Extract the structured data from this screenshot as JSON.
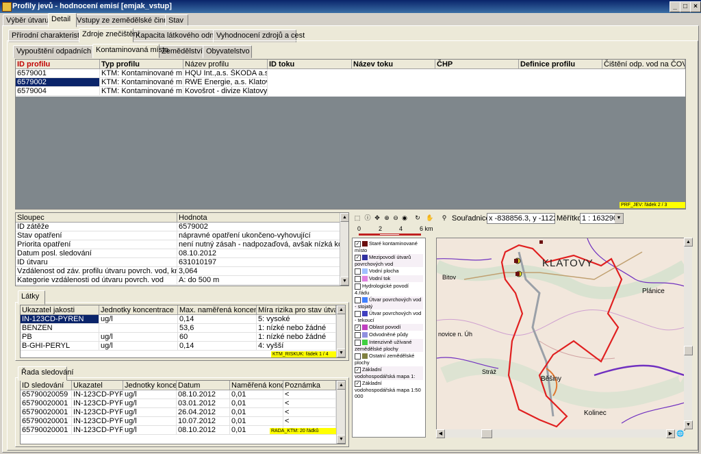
{
  "window": {
    "title": "Profily jevů - hodnocení emisí [emjak_vstup]"
  },
  "main_tabs": [
    "Výběr útvaru",
    "Detail",
    "Vstupy ze zemědělské činnosti",
    "Stav"
  ],
  "sub_tabs": [
    "Přírodní charakteristiky",
    "Zdroje znečištění",
    "Kapacita látkového odnosu",
    "Vyhodnocení zdrojů a cest"
  ],
  "source_tabs": [
    "Vypouštění odpadních vod",
    "Kontaminovaná místa",
    "Zemědělství",
    "Obyvatelstvo"
  ],
  "profiles": {
    "headers": [
      "ID profilu",
      "Typ profilu",
      "Název profilu",
      "ID toku",
      "Název toku",
      "ČHP",
      "Definice profilu",
      "Čištění odp. vod na ČOV"
    ],
    "rows": [
      [
        "6579001",
        "KTM: Kontaminované místo",
        "HQU Int.,a.s. ŠKODA a.s  Klat"
      ],
      [
        "6579002",
        "KTM: Kontaminované místo",
        "RWE Energie, a.s. Klatovy"
      ],
      [
        "6579004",
        "KTM: Kontaminované místo",
        "Kovošrot - divize Klatovy"
      ]
    ],
    "status": "PRF_JEV: řádek 2 / 3"
  },
  "details": {
    "headers": [
      "Sloupec",
      "Hodnota"
    ],
    "rows": [
      [
        "ID zátěže",
        "6579002"
      ],
      [
        "Stav opatření",
        "nápravné opatření ukončeno-vyhovující"
      ],
      [
        "Priorita opatření",
        "není nutný zásah - nadpozaďová, avšak nízká  kontaminac"
      ],
      [
        "Datum posl. sledování",
        "08.10.2012"
      ],
      [
        "ID útvaru",
        "631010197"
      ],
      [
        "Vzdálenost od záv. profilu útvaru povrch. vod, km",
        "3,064"
      ],
      [
        "Kategorie vzdálenosti od útvaru povrch. vod",
        "A: do 500 m"
      ]
    ]
  },
  "latky": {
    "tab": "Látky",
    "headers": [
      "Ukazatel jakosti",
      "Jednotky koncentrace",
      "Max. naměřená koncentrac",
      "Míra rizika pro stav útvaru p"
    ],
    "rows": [
      [
        "IN-123CD-PYREN",
        "ug/l",
        "0,14",
        "5: vysoké"
      ],
      [
        "BENZEN",
        "",
        "53,6",
        "1: nízké nebo žádné"
      ],
      [
        "PB",
        "ug/l",
        "60",
        "1: nízké nebo žádné"
      ],
      [
        "B-GHI-PERYL",
        "ug/l",
        "0,14",
        "4: vyšší"
      ]
    ],
    "status": "KTM_RISKUK: řádek 1 / 4"
  },
  "rada": {
    "tab": "Řada sledování",
    "headers": [
      "ID sledování",
      "Ukazatel",
      "Jednotky koncen",
      "Datum",
      "Naměřená koncer",
      "Poznámka"
    ],
    "rows": [
      [
        "65790020059",
        "IN-123CD-PYREN",
        "ug/l",
        "08.10.2012",
        "0,01",
        "<"
      ],
      [
        "65790020001",
        "IN-123CD-PYREN",
        "ug/l",
        "03.01.2012",
        "0,01",
        "<"
      ],
      [
        "65790020001",
        "IN-123CD-PYREN",
        "ug/l",
        "26.04.2012",
        "0,01",
        "<"
      ],
      [
        "65790020001",
        "IN-123CD-PYREN",
        "ug/l",
        "10.07.2012",
        "0,01",
        "<"
      ],
      [
        "65790020001",
        "IN-123CD-PYREN",
        "ug/l",
        "08.10.2012",
        "0,01",
        ""
      ]
    ],
    "status": "RADA_KTM: 20 řádků"
  },
  "map": {
    "coords_label": "Souřadnice:",
    "coords_value": "x -838856.3, y -11224",
    "scale_label": "Měřítko:",
    "scale_value": "1 : 163290",
    "scalebar": [
      "0",
      "2",
      "4",
      "6 km"
    ],
    "place_labels": [
      "KLATOVY",
      "Plánice",
      "Bitov",
      "Běšiny",
      "Kolinec",
      "Stráž",
      "novice n. Úh"
    ],
    "legend": [
      {
        "label": "Staré kontaminované místo",
        "color": "#6b1010",
        "checked": true
      },
      {
        "label": "Mezipovodí útvarů povrchových vod",
        "color": "#3030a0",
        "checked": true
      },
      {
        "label": "Vodní plocha",
        "color": "#a0c0ff",
        "checked": false
      },
      {
        "label": "Vodní tok",
        "color": "#e080e0",
        "checked": false
      },
      {
        "label": "Hydrologické povodí 4.řádu",
        "color": "",
        "checked": false
      },
      {
        "label": "Útvar povrchových vod - stojatý",
        "color": "#4080ff",
        "checked": false
      },
      {
        "label": "Útvar povrchových vod - tekoucí",
        "color": "#4040c0",
        "checked": false
      },
      {
        "label": "Oblast povodí",
        "color": "#c040c0",
        "checked": true
      },
      {
        "label": "Odvodněné půdy",
        "color": "#9090e0",
        "checked": false
      },
      {
        "label": "Intenzivně užívané zemědělské plochy",
        "color": "#40d040",
        "checked": false
      },
      {
        "label": "Ostatní zemědělské plochy",
        "color": "#808040",
        "checked": false
      },
      {
        "label": "Základní vodohospodářská mapa 1: 500 000",
        "color": "",
        "checked": true
      },
      {
        "label": "Základní vodohospodářská mapa 1:50 000",
        "color": "",
        "checked": true
      }
    ]
  },
  "colors": {
    "selection": "#0a246a",
    "status": "#ffff00",
    "boundary": "#e02020",
    "river": "#7030c0"
  }
}
